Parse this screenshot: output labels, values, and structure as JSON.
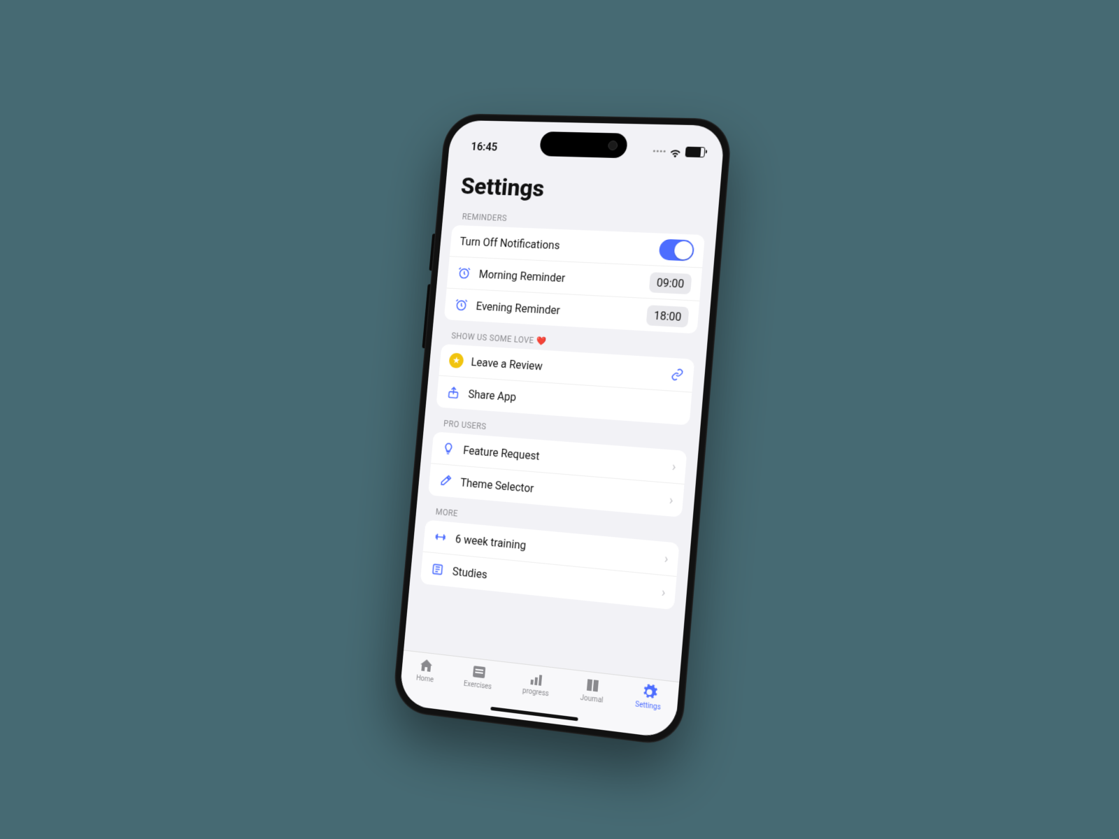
{
  "status": {
    "time": "16:45"
  },
  "title": "Settings",
  "sections": {
    "reminders": {
      "header": "REMINDERS",
      "notifications_label": "Turn Off Notifications",
      "notifications_on": true,
      "morning_label": "Morning Reminder",
      "morning_time": "09:00",
      "evening_label": "Evening Reminder",
      "evening_time": "18:00"
    },
    "love": {
      "header": "SHOW US SOME LOVE ❤️",
      "review_label": "Leave a Review",
      "share_label": "Share App"
    },
    "pro": {
      "header": "PRO USERS",
      "feature_label": "Feature Request",
      "theme_label": "Theme Selector"
    },
    "more": {
      "header": "MORE",
      "training_label": "6 week training",
      "studies_label": "Studies"
    }
  },
  "tabs": {
    "home": "Home",
    "exercises": "Exercises",
    "progress": "progress",
    "journal": "Journal",
    "settings": "Settings"
  }
}
